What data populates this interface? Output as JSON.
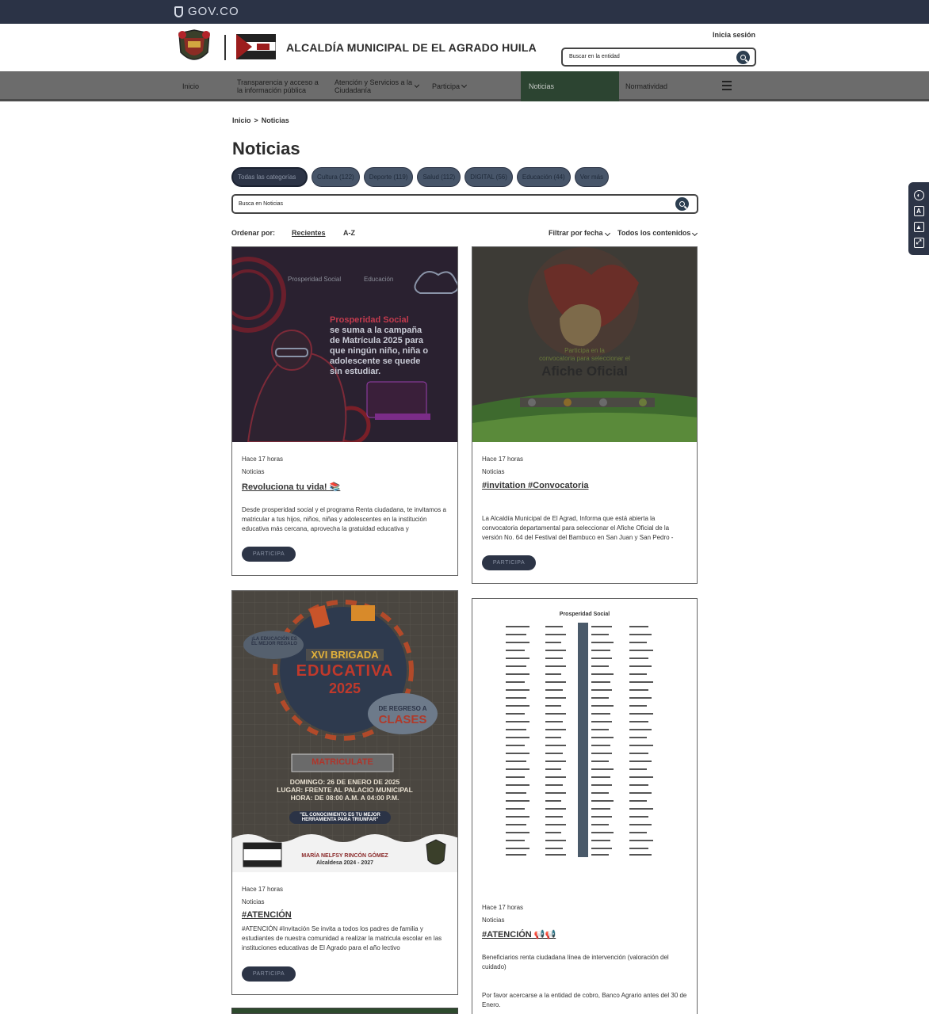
{
  "gov_bar": {
    "label": "GOV.CO"
  },
  "header": {
    "site_title": "ALCALDÍA MUNICIPAL DE EL AGRADO HUILA",
    "login": "Inicia sesión",
    "search_placeholder": "Buscar en la entidad"
  },
  "nav": {
    "items": [
      {
        "label": "Inicio"
      },
      {
        "label": "Transparencia y acceso a la información pública"
      },
      {
        "label": "Atención y Servicios a la Ciudadanía"
      },
      {
        "label": "Participa"
      },
      {
        "label": "Noticias"
      },
      {
        "label": "Normatividad"
      }
    ]
  },
  "breadcrumb": {
    "home": "Inicio",
    "sep": ">",
    "current": "Noticias"
  },
  "page_title": "Noticias",
  "categories": [
    {
      "label": "Todas las categorías"
    },
    {
      "label": "Cultura (122)"
    },
    {
      "label": "Deporte (119)"
    },
    {
      "label": "Salud (112)"
    },
    {
      "label": "DIGITAL (56)"
    },
    {
      "label": "Educación (44)"
    },
    {
      "label": "Ver más"
    }
  ],
  "news_search": {
    "placeholder": "Busca en Noticias"
  },
  "sort": {
    "label": "Ordenar por:",
    "recent": "Recientes",
    "az": "A-Z",
    "filter_date": "Filtrar por fecha",
    "all_content": "Todos los contenidos"
  },
  "cards": [
    {
      "time": "Hace 17 horas",
      "category": "Noticias",
      "title": "Revoluciona tu vida! 📚",
      "description": "Desde prosperidad social y el programa Renta ciudadana, te invitamos a matricular a tus hijos, niños, niñas y adolescentes en la institución educativa más cercana, aprovecha la gratuidad educativa y",
      "button": "PARTICIPA",
      "image": {
        "brand_left": "Prosperidad Social",
        "brand_right": "Educación",
        "line1": "Prosperidad Social",
        "line2": "se suma a la campaña",
        "line3": "de Matrícula 2025 para",
        "line4": "que ningún niño, niña o",
        "line5": "adolescente se quede",
        "line6": "sin estudiar."
      }
    },
    {
      "time": "Hace 17 horas",
      "category": "Noticias",
      "title": "#invitation #Convocatoria",
      "description": "La Alcaldía Municipal de El Agrad, Informa que está abierta la convocatoria departamental para seleccionar el Afiche Oficial de la versión No. 64 del Festival del Bambuco en San Juan y San Pedro -",
      "button": "PARTICIPA",
      "image": {
        "line1": "Participa en la",
        "line2": "convocatoria para seleccionar el",
        "line3": "Afiche Oficial"
      }
    },
    {
      "time": "Hace 17 horas",
      "category": "Noticias",
      "title": "#ATENCIÓN",
      "description": "#ATENCIÓN #Invitación Se invita a todos los padres de familia y estudiantes de nuestra comunidad a realizar la matricula escolar en las instituciones educativas de El Agrado para el año lectivo",
      "button": "PARTICIPA",
      "image": {
        "bubble": "¡LA EDUCACIÓN ES EL MEJOR REGALO",
        "brigade": "XVI BRIGADA",
        "edu": "EDUCATIVA",
        "year": "2025",
        "back1": "DE REGRESO A",
        "back2": "CLASES",
        "cta": "MATRICULATE",
        "date": "DOMINGO: 26 DE ENERO DE 2025",
        "place": "LUGAR: FRENTE AL PALACIO MUNICIPAL",
        "hour": "HORA: DE 08:00 A.M. A 04:00 P.M.",
        "motto": "\"EL CONOCIMIENTO ES TU MEJOR HERRAMIENTA PARA TRIUNFAR\"",
        "mayor": "MARÍA NELFSY RINCÓN GÓMEZ",
        "period": "Alcaldesa 2024 - 2027"
      }
    },
    {
      "time": "Hace 17 horas",
      "category": "Noticias",
      "title": "#ATENCIÓN 📢📢",
      "description": "Beneficiarios renta ciudadana línea de intervención (valoración del cuidado)",
      "description2": "Por favor acercarse a la entidad de cobro, Banco Agrario antes del 30 de Enero.",
      "image": {
        "header": "Prosperidad Social"
      }
    }
  ],
  "colors": {
    "gov_bar": "#2b3346",
    "nav_bg": "#6c6c6c",
    "nav_active": "#2c4431",
    "chip": "#475569",
    "button": "#2c3446"
  }
}
